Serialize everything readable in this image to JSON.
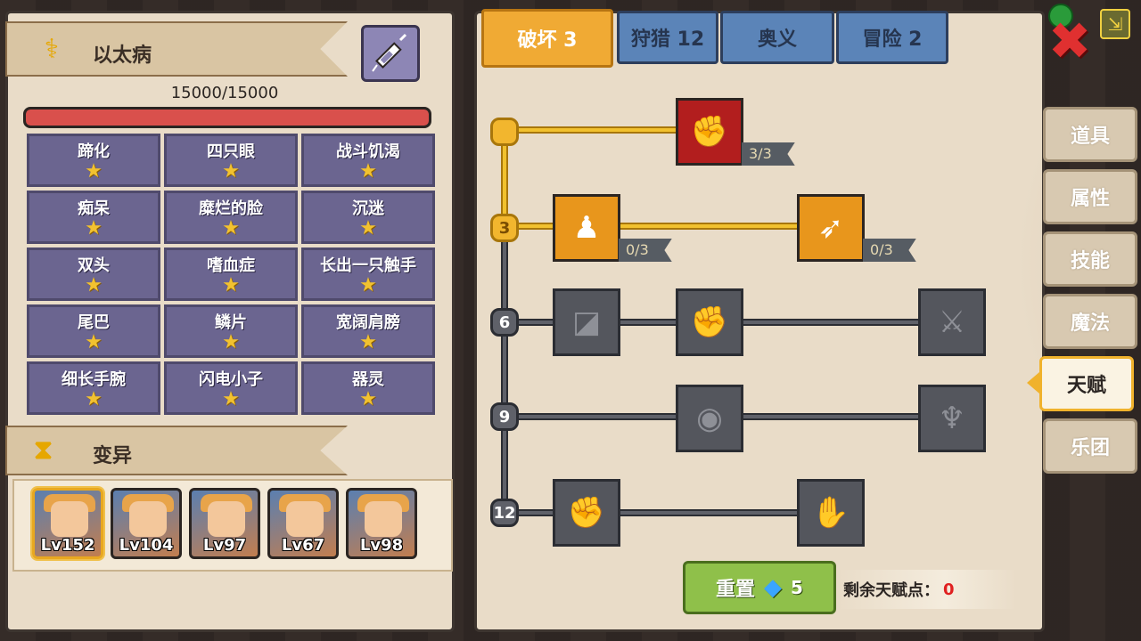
{
  "disease": {
    "title": "以太病",
    "hp_text": "15000/15000",
    "hp_fraction": 1.0
  },
  "traits": [
    {
      "label": "蹄化"
    },
    {
      "label": "四只眼"
    },
    {
      "label": "战斗饥渴"
    },
    {
      "label": "痴呆"
    },
    {
      "label": "糜烂的脸"
    },
    {
      "label": "沉迷"
    },
    {
      "label": "双头"
    },
    {
      "label": "嗜血症"
    },
    {
      "label": "长出一只触手"
    },
    {
      "label": "尾巴"
    },
    {
      "label": "鳞片"
    },
    {
      "label": "宽阔肩膀"
    },
    {
      "label": "细长手腕"
    },
    {
      "label": "闪电小子"
    },
    {
      "label": "器灵"
    }
  ],
  "mutation": {
    "title": "变异"
  },
  "heroes": [
    {
      "level": "Lv152",
      "selected": true
    },
    {
      "level": "Lv104",
      "selected": false
    },
    {
      "level": "Lv97",
      "selected": false
    },
    {
      "level": "Lv67",
      "selected": false
    },
    {
      "level": "Lv98",
      "selected": false
    }
  ],
  "tabs": [
    {
      "label": "破坏 3",
      "active": true
    },
    {
      "label": "狩猎 12",
      "active": false
    },
    {
      "label": "奥义",
      "active": false
    },
    {
      "label": "冒险 2",
      "active": false
    }
  ],
  "tree": {
    "tier_labels": [
      "3",
      "6",
      "9",
      "12"
    ],
    "counts": {
      "arm_wrestle": "3/3",
      "muscle": "0/3",
      "arrow": "0/3"
    }
  },
  "reset": {
    "label": "重置",
    "cost": "5"
  },
  "points": {
    "label": "剩余天赋点：",
    "value": "0"
  },
  "side_tabs": [
    {
      "label": "道具"
    },
    {
      "label": "属性"
    },
    {
      "label": "技能"
    },
    {
      "label": "魔法"
    },
    {
      "label": "天赋"
    },
    {
      "label": "乐团"
    }
  ]
}
